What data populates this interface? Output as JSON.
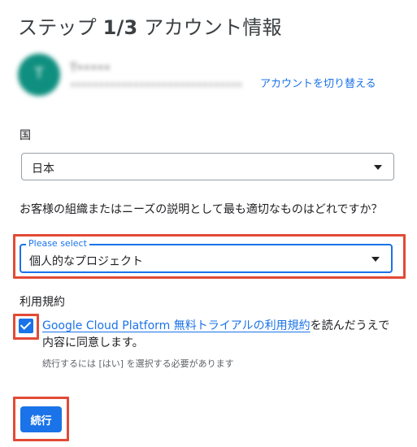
{
  "header": {
    "title_prefix": "ステップ",
    "step": "1/3",
    "title_suffix": "アカウント情報"
  },
  "account": {
    "initial": "T",
    "name": "T•••••",
    "email": "••••••••••••••••••••••••••••••",
    "switch_label": "アカウントを切り替える",
    "avatar_color": "#0f8f7f"
  },
  "country": {
    "label": "国",
    "value": "日本"
  },
  "organization": {
    "question": "お客様の組織またはニーズの説明として最も適切なものはどれですか？",
    "floating_label": "Please select",
    "value": "個人的なプロジェクト"
  },
  "terms": {
    "label": "利用規約",
    "checked": true,
    "link_text": "Google Cloud Platform 無料トライアルの利用規約",
    "after_text": "を読んだうえで内容に同意します。",
    "helper": "続行するには [はい] を選択する必要があります"
  },
  "actions": {
    "continue_label": "続行"
  },
  "colors": {
    "accent": "#1a73e8",
    "highlight": "#e24a36"
  },
  "icons": [
    "dropdown-arrow-icon",
    "checkmark-icon"
  ]
}
